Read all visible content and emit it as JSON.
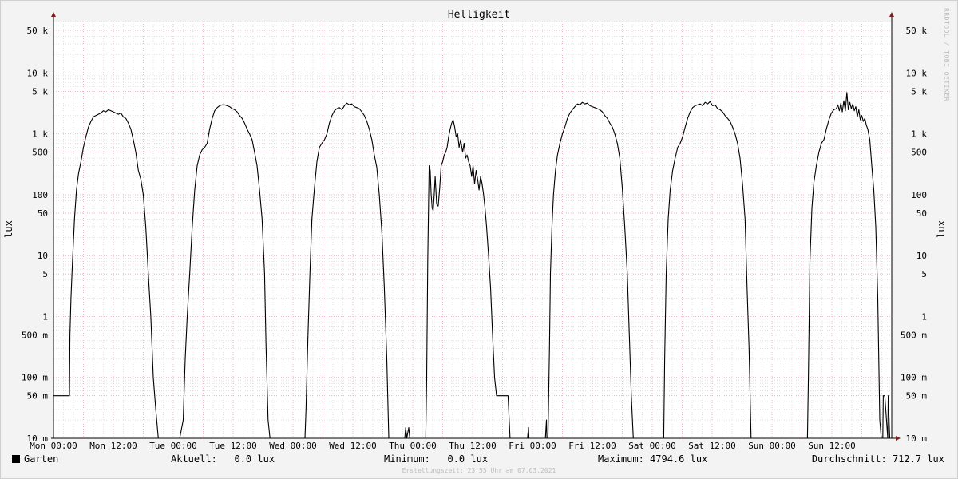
{
  "chart_data": {
    "type": "line",
    "title": "Helligkeit",
    "ylabel": "lux",
    "xlabel": "",
    "credit": "RRDTOOL / TOBI OETIKER",
    "log_scale_y": true,
    "ylim": [
      0.01,
      70000
    ],
    "xlim": [
      0,
      168
    ],
    "grid": true,
    "x_tick_values": [
      0,
      12,
      24,
      36,
      48,
      60,
      72,
      84,
      96,
      108,
      120,
      132,
      144,
      156
    ],
    "x_tick_labels": [
      "Mon 00:00",
      "Mon 12:00",
      "Tue 00:00",
      "Tue 12:00",
      "Wed 00:00",
      "Wed 12:00",
      "Thu 00:00",
      "Thu 12:00",
      "Fri 00:00",
      "Fri 12:00",
      "Sat 00:00",
      "Sat 12:00",
      "Sun 00:00",
      "Sun 12:00"
    ],
    "y_tick_values": [
      0.01,
      0.05,
      0.1,
      0.5,
      1,
      5,
      10,
      50,
      100,
      500,
      1000,
      5000,
      10000,
      50000
    ],
    "y_tick_labels": [
      "10 m",
      "50 m",
      "100 m",
      "500 m",
      "1",
      "5",
      "10",
      "50",
      "100",
      "500",
      "1 k",
      "5 k",
      "10 k",
      "50 k"
    ],
    "colors": {
      "line": "#000000",
      "major_grid": "#f2a5b8",
      "minor_grid": "#cfcfcf",
      "axis": "#7a1f1f"
    },
    "series": [
      {
        "name": "Garten",
        "x": [
          0,
          3.2,
          3.3,
          3.5,
          3.8,
          4.2,
          4.6,
          5,
          5.5,
          6,
          6.5,
          7,
          7.5,
          8,
          8.5,
          9,
          9.5,
          10,
          10.5,
          11,
          11.5,
          12,
          12.5,
          13,
          13.5,
          14,
          14.5,
          15,
          15.5,
          16,
          16.5,
          17,
          17.5,
          18,
          18.5,
          19,
          19.5,
          20,
          20.5,
          21,
          21.5,
          22,
          24,
          25.3,
          26,
          26.4,
          26.8,
          27.3,
          27.8,
          28.3,
          28.8,
          29.3,
          29.8,
          30.3,
          30.8,
          31.3,
          31.8,
          32.3,
          32.8,
          33.3,
          33.8,
          34.3,
          34.8,
          35.3,
          35.8,
          36.3,
          36.8,
          37.3,
          37.8,
          38.3,
          38.8,
          39.3,
          39.8,
          40.3,
          40.8,
          41.3,
          41.8,
          42.3,
          42.6,
          43,
          43.4,
          43.8,
          48,
          50.4,
          50.6,
          51,
          51.4,
          51.8,
          52.3,
          52.8,
          53.3,
          53.8,
          54.3,
          54.8,
          55.3,
          55.8,
          56.3,
          56.8,
          57.3,
          57.8,
          58.3,
          58.8,
          59.3,
          59.8,
          60.3,
          60.8,
          61.3,
          61.8,
          62.3,
          62.8,
          63.3,
          63.8,
          64.3,
          64.8,
          65.3,
          65.8,
          66.3,
          66.8,
          67.2,
          67.6,
          68,
          70.4,
          70.6,
          70.8,
          71.2,
          71.4,
          74.6,
          74.8,
          75,
          75.2,
          75.3,
          75.5,
          75.7,
          75.9,
          76.1,
          76.3,
          76.5,
          76.8,
          77.1,
          77.4,
          77.7,
          78,
          78.3,
          78.6,
          78.9,
          79.2,
          79.5,
          79.8,
          80.1,
          80.4,
          80.7,
          81,
          81.3,
          81.6,
          82,
          82.3,
          82.6,
          82.9,
          83.2,
          83.5,
          83.8,
          84.1,
          84.4,
          84.7,
          85,
          85.3,
          85.6,
          85.9,
          86.2,
          86.5,
          86.8,
          87.2,
          87.6,
          88,
          88.4,
          88.8,
          89.2,
          89.5,
          89.8,
          90.1,
          90.4,
          90.6,
          90.8,
          91.1,
          91.5,
          95,
          95.2,
          95.3,
          95.8,
          95.9,
          98.6,
          98.8,
          98.9,
          99.1,
          99.4,
          99.6,
          99.9,
          100.2,
          100.6,
          101,
          101.5,
          102,
          102.5,
          103,
          103.5,
          104,
          104.5,
          105,
          105.5,
          106,
          106.5,
          107,
          107.5,
          108,
          108.5,
          109,
          109.5,
          110,
          110.5,
          111,
          111.5,
          112,
          112.5,
          113,
          113.5,
          114,
          114.5,
          115,
          115.4,
          115.8,
          116.2,
          116.6,
          120,
          122.3,
          122.5,
          122.8,
          123.2,
          123.6,
          124.1,
          124.6,
          125.1,
          125.6,
          126.1,
          126.6,
          127.1,
          127.6,
          128.1,
          128.6,
          129.1,
          129.6,
          130.1,
          130.6,
          131.1,
          131.6,
          132.1,
          132.6,
          133.1,
          133.6,
          134.1,
          134.6,
          135.1,
          135.6,
          136.1,
          136.6,
          137.1,
          137.6,
          138.1,
          138.6,
          139,
          139.4,
          139.8,
          140.2,
          140.6,
          144,
          151.1,
          151.3,
          151.6,
          152,
          152.4,
          152.9,
          153.4,
          153.9,
          154.4,
          154.9,
          155.4,
          155.9,
          156.4,
          156.9,
          157.2,
          157.5,
          157.8,
          158.1,
          158.4,
          158.7,
          159,
          159.3,
          159.6,
          159.9,
          160.2,
          160.5,
          160.8,
          161.1,
          161.4,
          161.7,
          162,
          162.3,
          162.6,
          162.9,
          163.2,
          163.6,
          164,
          164.4,
          164.8,
          165.2,
          165.6,
          165.9,
          166.2,
          166.3,
          166.5,
          166.6,
          167.2,
          167.3,
          167.6,
          168
        ],
        "values": [
          0.05,
          0.05,
          0.5,
          2,
          8,
          40,
          120,
          220,
          350,
          600,
          900,
          1300,
          1600,
          1900,
          2000,
          2100,
          2200,
          2400,
          2300,
          2500,
          2400,
          2300,
          2200,
          2100,
          2200,
          1900,
          1800,
          1500,
          1200,
          800,
          500,
          250,
          180,
          100,
          30,
          5,
          1,
          0.1,
          0.03,
          0.01,
          0.01,
          0.01,
          0.01,
          0.01,
          0.02,
          0.2,
          1,
          5,
          30,
          120,
          300,
          450,
          550,
          600,
          700,
          1200,
          1800,
          2400,
          2700,
          2900,
          3000,
          3000,
          2900,
          2800,
          2600,
          2500,
          2300,
          2000,
          1800,
          1500,
          1200,
          1000,
          800,
          500,
          300,
          120,
          40,
          5,
          0.3,
          0.02,
          0.01,
          0.01,
          0.01,
          0.01,
          0.03,
          0.5,
          5,
          40,
          130,
          350,
          600,
          700,
          800,
          1000,
          1500,
          2000,
          2400,
          2600,
          2700,
          2500,
          2900,
          3200,
          3000,
          3100,
          2800,
          2700,
          2600,
          2300,
          2000,
          1600,
          1200,
          800,
          450,
          280,
          100,
          25,
          3,
          0.2,
          0.01,
          0.01,
          0.01,
          0.01,
          0.015,
          0.01,
          0.015,
          0.01,
          0.01,
          0.1,
          8,
          100,
          300,
          250,
          100,
          60,
          55,
          100,
          200,
          70,
          65,
          130,
          300,
          350,
          450,
          500,
          600,
          900,
          1200,
          1500,
          1700,
          1300,
          900,
          1000,
          600,
          800,
          500,
          700,
          400,
          450,
          350,
          300,
          200,
          300,
          150,
          250,
          180,
          120,
          200,
          150,
          100,
          60,
          30,
          10,
          3,
          0.5,
          0.1,
          0.05,
          0.05,
          0.05,
          0.05,
          0.05,
          0.05,
          0.05,
          0.05,
          0.05,
          0.01,
          0.01,
          0.015,
          0.01,
          0.01,
          0.01,
          0.01,
          0.02,
          0.01,
          0.01,
          0.3,
          5,
          30,
          100,
          250,
          450,
          700,
          1000,
          1300,
          1800,
          2200,
          2500,
          2800,
          3100,
          3000,
          3300,
          3100,
          3200,
          2900,
          2800,
          2700,
          2600,
          2500,
          2300,
          2000,
          1800,
          1500,
          1300,
          1000,
          700,
          400,
          130,
          30,
          5,
          0.5,
          0.05,
          0.01,
          0.01,
          0.01,
          0.01,
          0.2,
          5,
          40,
          120,
          250,
          400,
          600,
          700,
          900,
          1300,
          1800,
          2300,
          2700,
          2900,
          3000,
          3100,
          2900,
          3300,
          3100,
          3400,
          2900,
          3000,
          2600,
          2500,
          2300,
          2000,
          1800,
          1600,
          1300,
          1000,
          700,
          400,
          150,
          40,
          3,
          0.3,
          0.01,
          0.01,
          0.01,
          0.01,
          0.01,
          0.1,
          8,
          60,
          160,
          300,
          500,
          700,
          800,
          1200,
          1700,
          2200,
          2500,
          2600,
          3000,
          2400,
          3200,
          2300,
          3500,
          2400,
          4794.6,
          2500,
          3300,
          2600,
          3100,
          2400,
          2800,
          1900,
          2500,
          1700,
          2000,
          1600,
          1800,
          1400,
          1200,
          800,
          300,
          120,
          30,
          2,
          0.02,
          0.01,
          0.01,
          0.05,
          0.05,
          0.05,
          0.01,
          0.05,
          0.01,
          0.01
        ]
      }
    ]
  },
  "legend": {
    "current": "Aktuell:   0.0 lux",
    "minimum": "Minimum:   0.0 lux",
    "maximum": "Maximum: 4794.6 lux",
    "average": "Durchschnitt: 712.7 lux"
  },
  "footer_text": "Erstellungszeit: 23:55 Uhr am 07.03.2021"
}
